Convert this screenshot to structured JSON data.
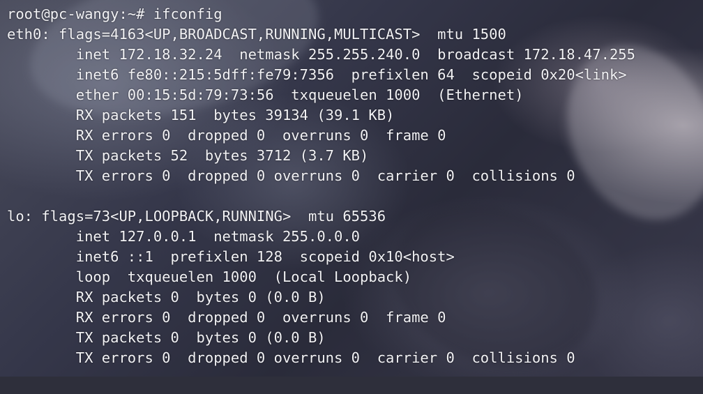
{
  "terminal": {
    "lines": [
      "root@pc-wangy:~# ifconfig",
      "eth0: flags=4163<UP,BROADCAST,RUNNING,MULTICAST>  mtu 1500",
      "        inet 172.18.32.24  netmask 255.255.240.0  broadcast 172.18.47.255",
      "        inet6 fe80::215:5dff:fe79:7356  prefixlen 64  scopeid 0x20<link>",
      "        ether 00:15:5d:79:73:56  txqueuelen 1000  (Ethernet)",
      "        RX packets 151  bytes 39134 (39.1 KB)",
      "        RX errors 0  dropped 0  overruns 0  frame 0",
      "        TX packets 52  bytes 3712 (3.7 KB)",
      "        TX errors 0  dropped 0 overruns 0  carrier 0  collisions 0",
      "",
      "lo: flags=73<UP,LOOPBACK,RUNNING>  mtu 65536",
      "        inet 127.0.0.1  netmask 255.0.0.0",
      "        inet6 ::1  prefixlen 128  scopeid 0x10<host>",
      "        loop  txqueuelen 1000  (Local Loopback)",
      "        RX packets 0  bytes 0 (0.0 B)",
      "        RX errors 0  dropped 0  overruns 0  frame 0",
      "        TX packets 0  bytes 0 (0.0 B)",
      "        TX errors 0  dropped 0 overruns 0  carrier 0  collisions 0"
    ]
  }
}
